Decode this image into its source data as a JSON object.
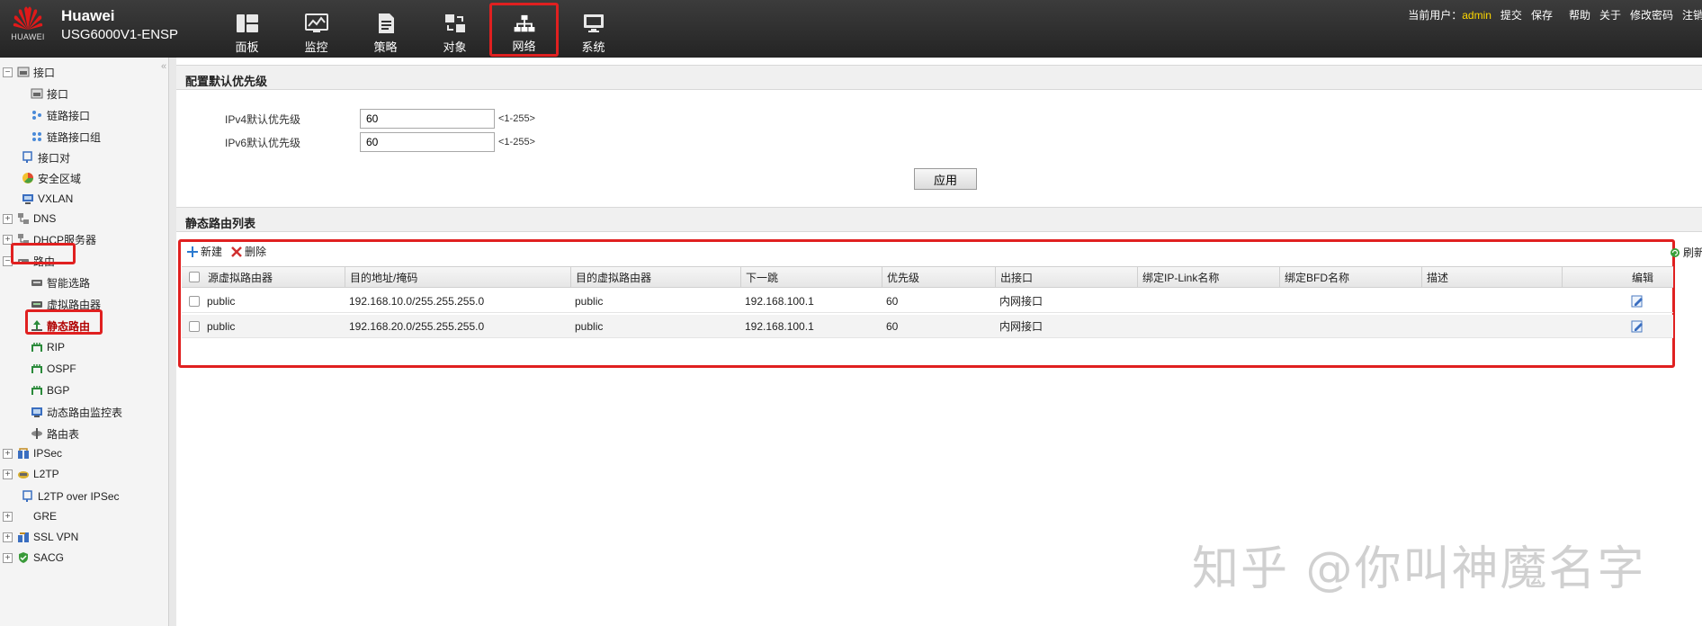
{
  "header": {
    "logo_text": "HUAWEI",
    "brand_name": "Huawei",
    "model": "USG6000V1-ENSP",
    "nav": [
      {
        "label": "面板",
        "icon": "dashboard-icon"
      },
      {
        "label": "监控",
        "icon": "monitor-icon"
      },
      {
        "label": "策略",
        "icon": "policy-icon"
      },
      {
        "label": "对象",
        "icon": "object-icon"
      },
      {
        "label": "网络",
        "icon": "network-icon"
      },
      {
        "label": "系统",
        "icon": "system-icon"
      }
    ],
    "active_nav": "网络",
    "user_label": "当前用户：",
    "user_name": "admin",
    "links": [
      "提交",
      "保存",
      "帮助",
      "关于",
      "修改密码",
      "注销"
    ]
  },
  "sidebar": {
    "items": [
      {
        "label": "接口",
        "toggle": "−"
      },
      {
        "label": "接口"
      },
      {
        "label": "链路接口"
      },
      {
        "label": "链路接口组"
      },
      {
        "label": "接口对"
      },
      {
        "label": "安全区域"
      },
      {
        "label": "VXLAN"
      },
      {
        "label": "DNS",
        "toggle": "+"
      },
      {
        "label": "DHCP服务器",
        "toggle": "+"
      },
      {
        "label": "路由",
        "toggle": "−"
      },
      {
        "label": "智能选路"
      },
      {
        "label": "虚拟路由器"
      },
      {
        "label": "静态路由"
      },
      {
        "label": "RIP"
      },
      {
        "label": "OSPF"
      },
      {
        "label": "BGP"
      },
      {
        "label": "动态路由监控表"
      },
      {
        "label": "路由表"
      },
      {
        "label": "IPSec",
        "toggle": "+"
      },
      {
        "label": "L2TP",
        "toggle": "+"
      },
      {
        "label": "L2TP over IPSec"
      },
      {
        "label": "GRE",
        "toggle": "+"
      },
      {
        "label": "SSL VPN",
        "toggle": "+"
      },
      {
        "label": "SACG",
        "toggle": "+"
      }
    ],
    "selected": "静态路由"
  },
  "priority_panel": {
    "title": "配置默认优先级",
    "ipv4_label": "IPv4默认优先级",
    "ipv4_value": "60",
    "ipv6_label": "IPv6默认优先级",
    "ipv6_value": "60",
    "range_hint": "<1-255>",
    "apply_label": "应用"
  },
  "route_panel": {
    "title": "静态路由列表",
    "new_label": "新建",
    "delete_label": "删除",
    "refresh_label": "刷新",
    "columns": [
      "源虚拟路由器",
      "目的地址/掩码",
      "目的虚拟路由器",
      "下一跳",
      "优先级",
      "出接口",
      "绑定IP-Link名称",
      "绑定BFD名称",
      "描述",
      "编辑"
    ],
    "rows": [
      {
        "src_vr": "public",
        "dest": "192.168.10.0/255.255.255.0",
        "dest_vr": "public",
        "next_hop": "192.168.100.1",
        "priority": "60",
        "out_if": "内网接口",
        "ip_link": "",
        "bfd": "",
        "desc": ""
      },
      {
        "src_vr": "public",
        "dest": "192.168.20.0/255.255.255.0",
        "dest_vr": "public",
        "next_hop": "192.168.100.1",
        "priority": "60",
        "out_if": "内网接口",
        "ip_link": "",
        "bfd": "",
        "desc": ""
      }
    ]
  },
  "watermark": "知乎 @你叫神魔名字",
  "colors": {
    "accent_red": "#e02020",
    "topbar": "#2e2e2e",
    "admin": "#ffd800"
  }
}
